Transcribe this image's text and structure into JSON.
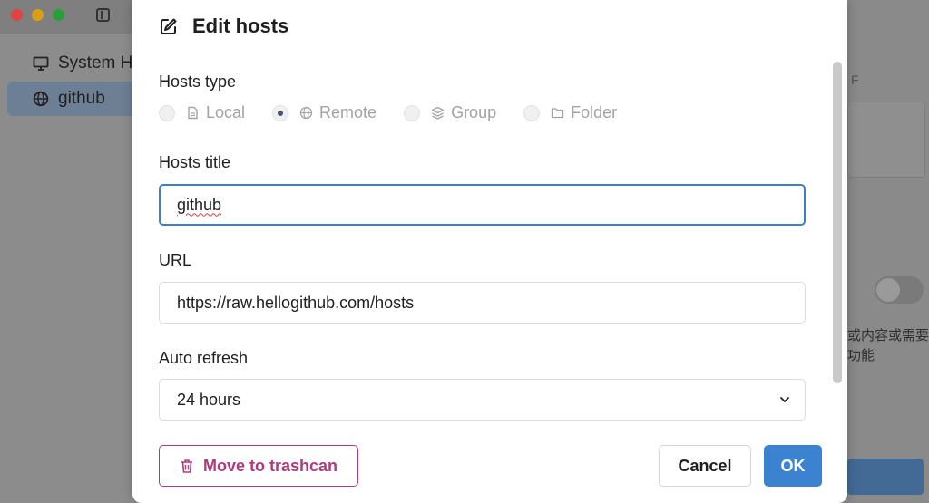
{
  "sidebar": {
    "items": [
      {
        "label": "System H",
        "icon": "monitor-icon"
      },
      {
        "label": "github",
        "icon": "globe-icon"
      }
    ]
  },
  "right_pane": {
    "fragment_f": "F",
    "text_line1": "或内容或需要",
    "text_line2": "功能"
  },
  "dialog": {
    "title": "Edit hosts",
    "hosts_type": {
      "label": "Hosts type",
      "options": [
        {
          "label": "Local",
          "icon": "file-icon",
          "checked": false
        },
        {
          "label": "Remote",
          "icon": "globe-icon",
          "checked": true
        },
        {
          "label": "Group",
          "icon": "layers-icon",
          "checked": false
        },
        {
          "label": "Folder",
          "icon": "folder-icon",
          "checked": false
        }
      ]
    },
    "hosts_title": {
      "label": "Hosts title",
      "value": "github"
    },
    "url": {
      "label": "URL",
      "value": "https://raw.hellogithub.com/hosts"
    },
    "auto_refresh": {
      "label": "Auto refresh",
      "value": "24 hours"
    },
    "buttons": {
      "trash": "Move to trashcan",
      "cancel": "Cancel",
      "ok": "OK"
    }
  },
  "colors": {
    "accent": "#3b83d1",
    "danger": "#b23a7c",
    "focus_border": "#3d7fc9"
  }
}
